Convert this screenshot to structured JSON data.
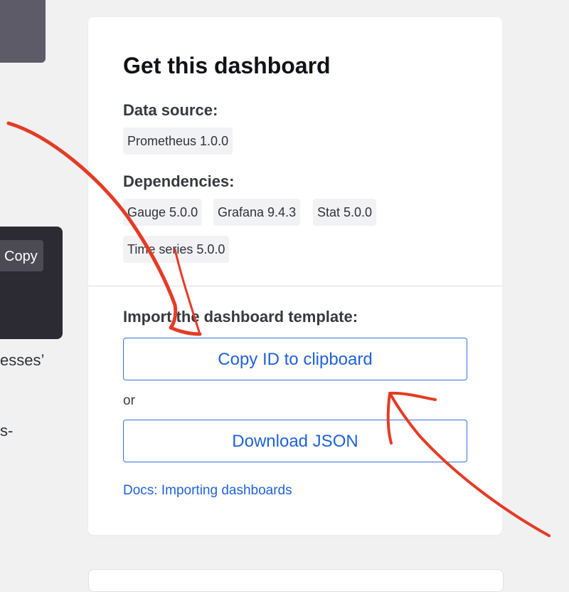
{
  "left_panel": {
    "copy_label": "Copy",
    "text_fragment_1": "esses’",
    "text_fragment_2": "s-"
  },
  "card": {
    "title": "Get this dashboard",
    "data_source_heading": "Data source:",
    "data_sources": [
      "Prometheus 1.0.0"
    ],
    "dependencies_heading": "Dependencies:",
    "dependencies": [
      "Gauge 5.0.0",
      "Grafana 9.4.3",
      "Stat 5.0.0",
      "Time series 5.0.0"
    ],
    "import_heading": "Import the dashboard template:",
    "copy_id_label": "Copy ID to clipboard",
    "or_label": "or",
    "download_json_label": "Download JSON",
    "docs_link": "Docs: Importing dashboards"
  },
  "colors": {
    "accent": "#1f62d6",
    "annotation": "#e43b25"
  }
}
